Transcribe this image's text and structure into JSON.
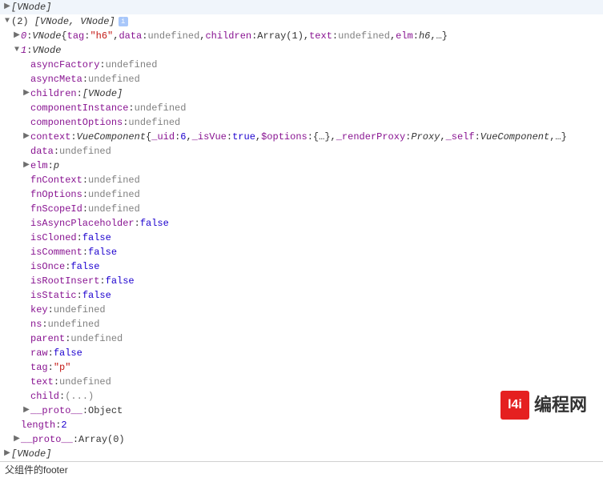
{
  "root0": {
    "label": "[VNode]"
  },
  "expanded": {
    "header": {
      "len": "(2)",
      "label": "[VNode, VNode]"
    },
    "item0": {
      "idx": "0",
      "type": "VNode",
      "tag_k": "tag",
      "tag_v": "\"h6\"",
      "data_k": "data",
      "data_v": "undefined",
      "children_k": "children",
      "children_v": "Array(1)",
      "text_k": "text",
      "text_v": "undefined",
      "elm_k": "elm",
      "elm_v": "h6",
      "more": "…"
    },
    "item1": {
      "idx": "1",
      "type": "VNode",
      "asyncFactory": {
        "k": "asyncFactory",
        "v": "undefined"
      },
      "asyncMeta": {
        "k": "asyncMeta",
        "v": "undefined"
      },
      "children": {
        "k": "children",
        "v": "[VNode]"
      },
      "componentInstance": {
        "k": "componentInstance",
        "v": "undefined"
      },
      "componentOptions": {
        "k": "componentOptions",
        "v": "undefined"
      },
      "context": {
        "k": "context",
        "type": "VueComponent",
        "uid_k": "_uid",
        "uid_v": "6",
        "isVue_k": "_isVue",
        "isVue_v": "true",
        "opts_k": "$options",
        "opts_v": "{…}",
        "rp_k": "_renderProxy",
        "rp_v": "Proxy",
        "self_k": "_self",
        "self_v": "VueComponent",
        "more": "…"
      },
      "data": {
        "k": "data",
        "v": "undefined"
      },
      "elm": {
        "k": "elm",
        "v": "p"
      },
      "fnContext": {
        "k": "fnContext",
        "v": "undefined"
      },
      "fnOptions": {
        "k": "fnOptions",
        "v": "undefined"
      },
      "fnScopeId": {
        "k": "fnScopeId",
        "v": "undefined"
      },
      "isAsyncPlaceholder": {
        "k": "isAsyncPlaceholder",
        "v": "false"
      },
      "isCloned": {
        "k": "isCloned",
        "v": "false"
      },
      "isComment": {
        "k": "isComment",
        "v": "false"
      },
      "isOnce": {
        "k": "isOnce",
        "v": "false"
      },
      "isRootInsert": {
        "k": "isRootInsert",
        "v": "false"
      },
      "isStatic": {
        "k": "isStatic",
        "v": "false"
      },
      "key": {
        "k": "key",
        "v": "undefined"
      },
      "ns": {
        "k": "ns",
        "v": "undefined"
      },
      "parent": {
        "k": "parent",
        "v": "undefined"
      },
      "raw": {
        "k": "raw",
        "v": "false"
      },
      "tag": {
        "k": "tag",
        "v": "\"p\""
      },
      "text": {
        "k": "text",
        "v": "undefined"
      },
      "child": {
        "k": "child",
        "v": "(...)"
      },
      "proto": {
        "k": "__proto__",
        "v": "Object"
      }
    },
    "length": {
      "k": "length",
      "v": "2"
    },
    "proto": {
      "k": "__proto__",
      "v": "Array(0)"
    }
  },
  "root2": {
    "label": "[VNode]"
  },
  "footer": "父组件的footer",
  "logo": {
    "text": "编程网",
    "icon": "l4i"
  }
}
